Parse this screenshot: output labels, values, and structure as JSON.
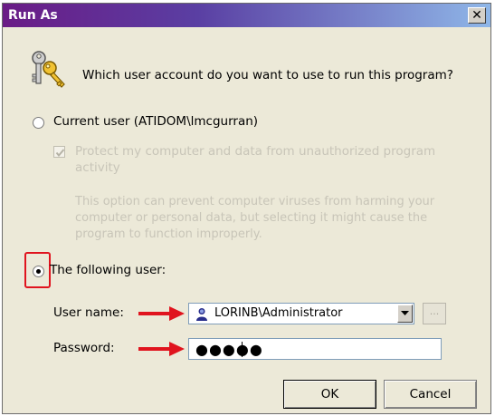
{
  "window": {
    "title": "Run As",
    "close_glyph": "✕"
  },
  "prompt": {
    "question": "Which user account do you want to use to run this program?",
    "icon": "keys-icon"
  },
  "current_user_option": {
    "label": "Current user (ATIDOM\\lmcgurran)",
    "selected": false
  },
  "protect_checkbox": {
    "label_line1": "Protect my computer and data from unauthorized program",
    "label_line2": "activity",
    "checked": true,
    "disabled": true
  },
  "protect_description": {
    "line1": "This option can prevent computer viruses from harming your",
    "line2": "computer or personal data, but selecting it might cause the",
    "line3": "program to function improperly."
  },
  "following_user_option": {
    "label": "The following user:",
    "selected": true
  },
  "user_name": {
    "label": "User name:",
    "value": "LORINB\\Administrator",
    "browse_label": "..."
  },
  "password": {
    "label": "Password:",
    "masked_value": "●●●●●"
  },
  "buttons": {
    "ok": "OK",
    "cancel": "Cancel"
  },
  "colors": {
    "annotation_red": "#e0141e",
    "title_gradient_start": "#6a1b86",
    "title_gradient_end": "#8fb7e8"
  }
}
